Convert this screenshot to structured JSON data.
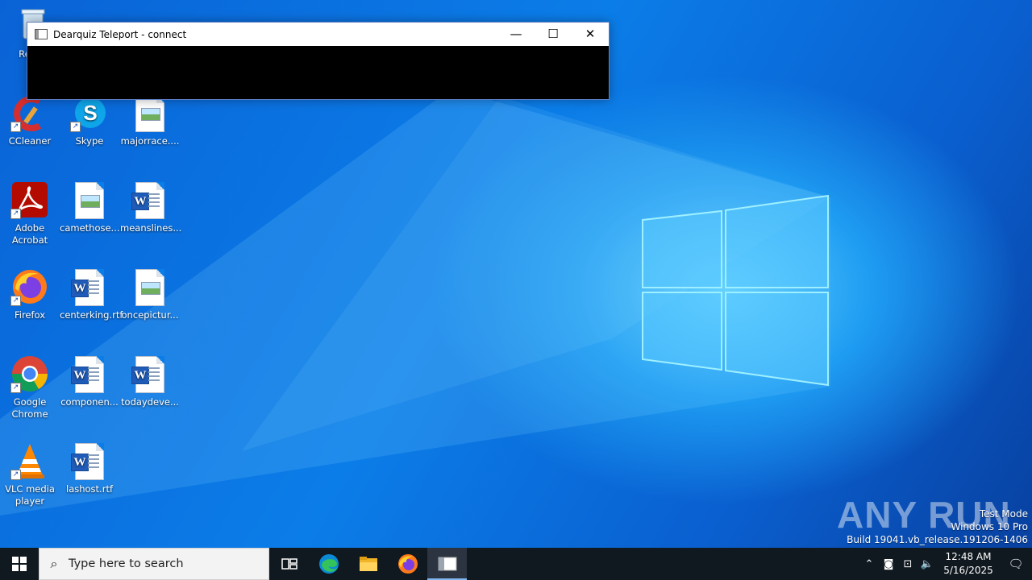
{
  "desktop": {
    "icons": [
      {
        "label": "Recy"
      },
      {
        "label": "CCleaner"
      },
      {
        "label": "Skype"
      },
      {
        "label": "majorrace...."
      },
      {
        "label": "Adobe Acrobat"
      },
      {
        "label": "camethose..."
      },
      {
        "label": "meanslines..."
      },
      {
        "label": "Firefox"
      },
      {
        "label": "centerking.rtf"
      },
      {
        "label": "oncepictur..."
      },
      {
        "label": "Google Chrome"
      },
      {
        "label": "componen..."
      },
      {
        "label": "todaydeve..."
      },
      {
        "label": "VLC media player"
      },
      {
        "label": "lashost.rtf"
      }
    ]
  },
  "window": {
    "title": "Dearquiz Teleport - connect",
    "minimize": "—",
    "maximize": "☐",
    "close": "✕"
  },
  "taskbar": {
    "search_placeholder": "Type here to search",
    "time": "12:48 AM",
    "date": "5/16/2025"
  },
  "watermark": {
    "line1": "Test Mode",
    "line2": "Windows 10 Pro",
    "line3": "Build 19041.vb_release.191206-1406",
    "brand": "ANY RUN"
  },
  "colors": {
    "taskbar": "#101820",
    "desktop_accent": "#0b7de8"
  }
}
